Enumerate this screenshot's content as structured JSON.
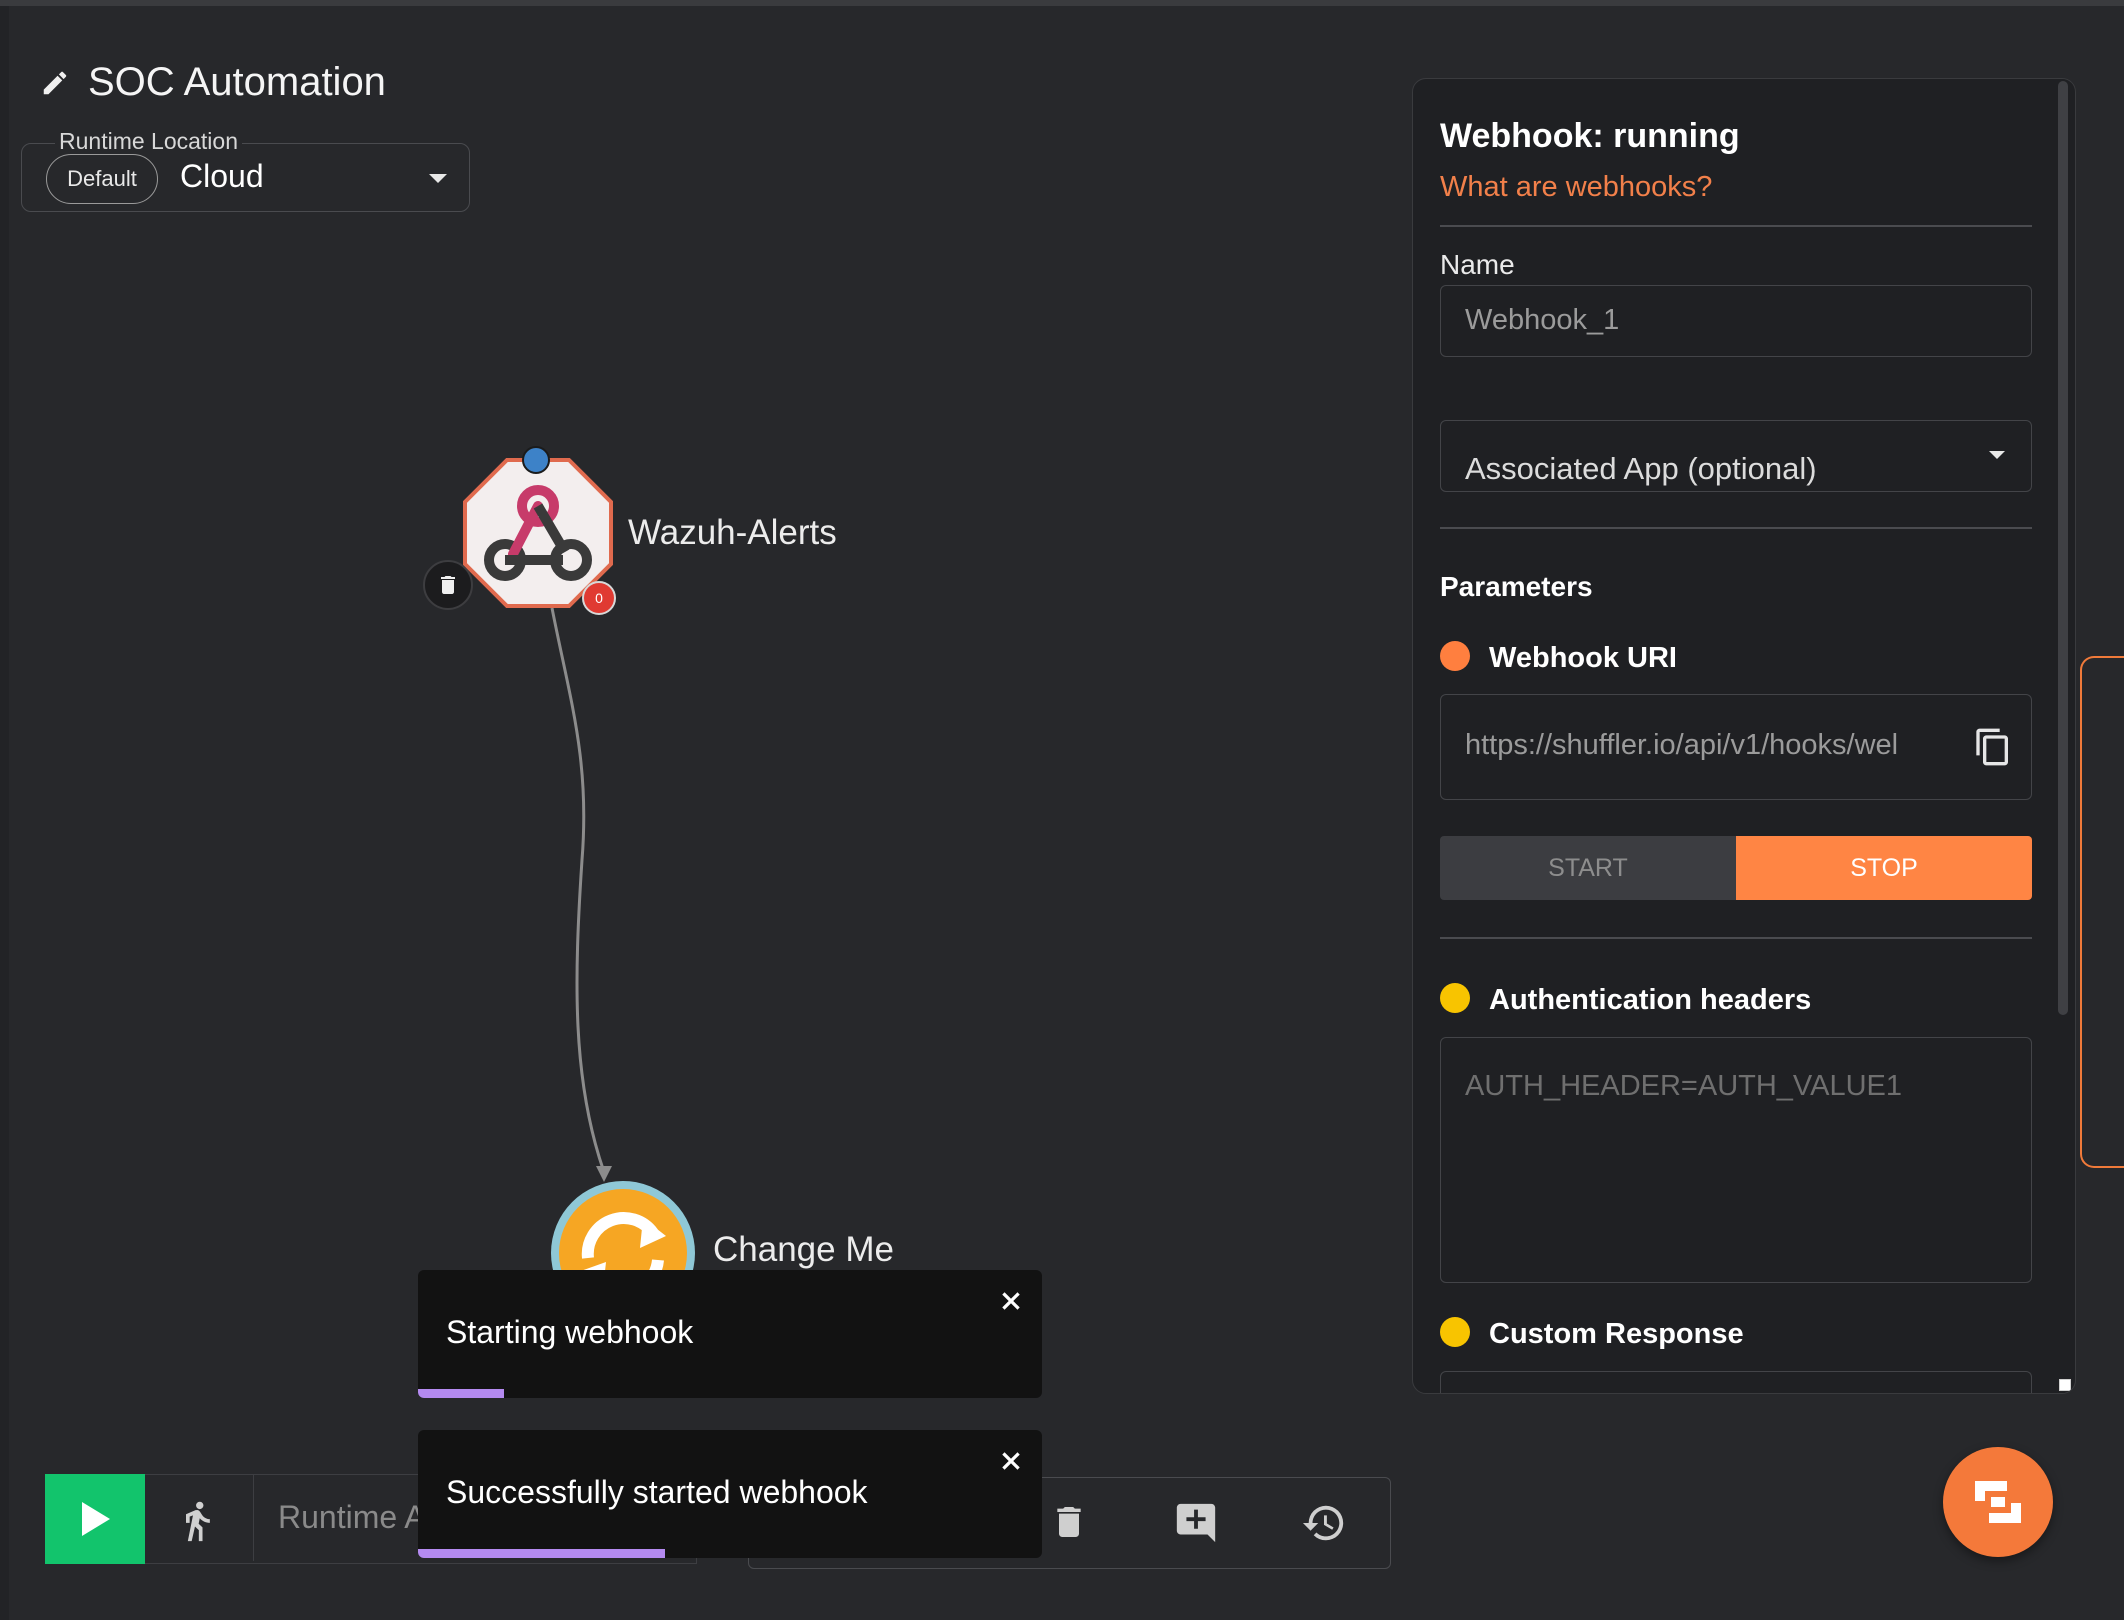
{
  "workflow": {
    "title": "SOC Automation",
    "runtime_location": {
      "label": "Runtime Location",
      "chip": "Default",
      "value": "Cloud"
    }
  },
  "canvas": {
    "nodes": [
      {
        "label": "Wazuh-Alerts",
        "badge": "0",
        "icon": "webhook-icon"
      },
      {
        "label": "Change Me",
        "icon": "sync-icon"
      }
    ]
  },
  "toasts": [
    {
      "message": "Starting webhook",
      "progress_percent": 10
    },
    {
      "message": "Successfully started webhook",
      "progress_percent": 29
    }
  ],
  "toolbar": {
    "runtime_argument_placeholder": "Runtime A",
    "icons": [
      "play-icon",
      "walker-icon",
      "trash-icon",
      "add-comment-icon",
      "history-icon"
    ]
  },
  "panel": {
    "title": "Webhook: running",
    "help_link": "What are webhooks?",
    "name_label": "Name",
    "name_value": "Webhook_1",
    "associated_app": "Associated App (optional)",
    "parameters_heading": "Parameters",
    "params": [
      {
        "label": "Webhook URI",
        "value": "https://shuffler.io/api/v1/hooks/wel",
        "dot_color": "#ff7f3f"
      },
      {
        "label": "Authentication headers",
        "placeholder": "AUTH_HEADER=AUTH_VALUE1",
        "dot_color": "#f8c400"
      },
      {
        "label": "Custom Response",
        "dot_color": "#f8c400"
      }
    ],
    "start_label": "START",
    "stop_label": "STOP"
  },
  "colors": {
    "accent": "#ff8544",
    "run_green": "#12c46c",
    "toast_progress": "#b48af0"
  }
}
